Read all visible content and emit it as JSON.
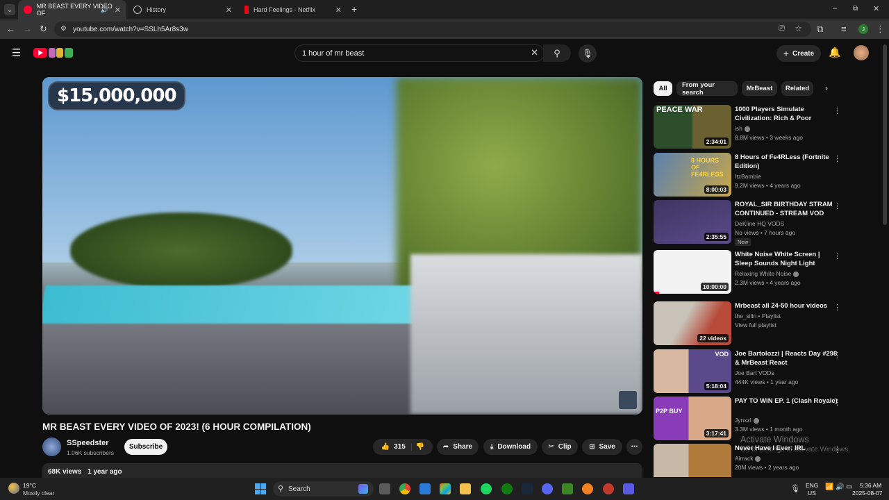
{
  "browser": {
    "tabs": [
      {
        "title": "MR BEAST EVERY VIDEO OF",
        "active": true
      },
      {
        "title": "History",
        "active": false
      },
      {
        "title": "Hard Feelings - Netflix",
        "active": false
      }
    ],
    "new_tab": "+",
    "url": "youtube.com/watch?v=SSLh5Ar8s3w",
    "window_controls": {
      "minimize": "–",
      "maximize": "⧉",
      "close": "✕"
    }
  },
  "youtube": {
    "search_value": "1 hour of mr beast",
    "create_label": "Create"
  },
  "video": {
    "overlay_text": "$15,000,000",
    "title": "MR BEAST EVERY VIDEO OF 2023! (6 HOUR COMPILATION)",
    "channel": "SSpeedster",
    "subscribers": "1.06K subscribers",
    "subscribe_label": "Subscribe",
    "likes": "315",
    "share_label": "Share",
    "download_label": "Download",
    "clip_label": "Clip",
    "save_label": "Save",
    "views": "68K views",
    "age": "1 year ago"
  },
  "chips": [
    "All",
    "From your search",
    "MrBeast",
    "Related"
  ],
  "recommendations": [
    {
      "title": "1000 Players Simulate Civilization: Rich & Poor",
      "channel": "ish",
      "verified": true,
      "meta": "8.8M views • 3 weeks ago",
      "duration": "2:34:01",
      "thumb_text": "PEACE  WAR",
      "color": "#3d6a2a"
    },
    {
      "title": "8 Hours of Fe4RLess (Fortnite Edition)",
      "channel": "ItzBambie",
      "verified": false,
      "meta": "9.2M views • 4 years ago",
      "duration": "8:00:03",
      "thumb_text": "8 HOURS OF FE4RLESS",
      "color": "#5a7ea6"
    },
    {
      "title": "ROYAL_SIR BIRTHDAY STRAM CONTINUED - STREAM VOD",
      "channel": "DeKline HQ VODS",
      "verified": false,
      "meta": "No views • 7 hours ago",
      "badge": "New",
      "duration": "2:35:55",
      "thumb_text": "",
      "color": "#4a3c6a"
    },
    {
      "title": "White Noise White Screen | Sleep Sounds Night Light",
      "channel": "Relaxing White Noise",
      "verified": true,
      "meta": "2.3M views • 4 years ago",
      "duration": "10:00:00",
      "thumb_text": "",
      "color": "#f2f2f2"
    },
    {
      "title": "Mrbeast all 24-50 hour videos",
      "channel": "the_silin • Playlist",
      "verified": false,
      "meta": "View full playlist",
      "duration": "22 videos",
      "thumb_text": "",
      "color": "#b84a3a"
    },
    {
      "title": "Joe Bartolozzi | Reacts Day #298 & MrBeast React",
      "channel": "Joe Bart VODs",
      "verified": false,
      "meta": "444K views • 1 year ago",
      "duration": "5:18:04",
      "thumb_text": "VOD",
      "color": "#6c5a8c"
    },
    {
      "title": "PAY TO WIN EP. 1 (Clash Royale)",
      "channel": "Jynxzi",
      "verified": true,
      "meta": "3.3M views • 1 month ago",
      "duration": "3:17:41",
      "thumb_text": "P2P  BUY",
      "color": "#8a3cb8"
    },
    {
      "title": "Never Have I Ever: IRL",
      "channel": "Airrack",
      "verified": true,
      "meta": "20M views • 2 years ago",
      "duration": "",
      "thumb_text": "",
      "color": "#b07a3a"
    }
  ],
  "watermark": {
    "line1": "Activate Windows",
    "line2": "Go to Settings to activate Windows."
  },
  "taskbar": {
    "weather_temp": "19°C",
    "weather_desc": "Mostly clear",
    "search_label": "Search",
    "lang": "ENG",
    "region": "US",
    "time": "5:36 AM",
    "date": "2025-08-07"
  },
  "colors": {
    "accent_red": "#ff0033",
    "bg": "#0f0f0f",
    "chip_bg": "#272727"
  }
}
